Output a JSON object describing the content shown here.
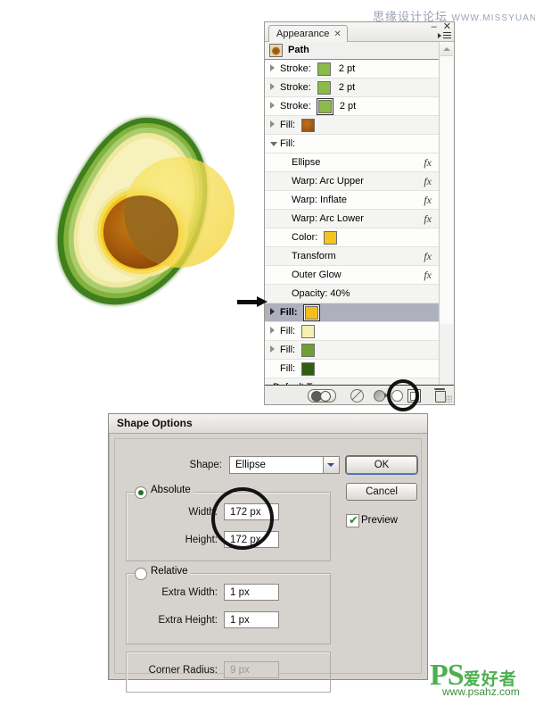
{
  "watermarks": {
    "top_cn": "思缘设计论坛",
    "top_url": "WWW.MISSYUAN.COM",
    "bottom_ps": "PS",
    "bottom_cn": "爱好者",
    "bottom_url": "www.psahz.com"
  },
  "artwork": {
    "name": "avocado-illustration",
    "colors": {
      "skin_dark": "#3f7a1e",
      "skin_mid": "#7fb03c",
      "skin_light": "#a8cc6a",
      "flesh_pale": "#f4f0a8",
      "flesh_rim": "#f7e36a",
      "ring_gold": "#f2c61e",
      "pit_dark": "#8a4a10",
      "pit_light": "#c1770f",
      "ellipse_yellow": "#f7d93a"
    }
  },
  "panel": {
    "tab_label": "Appearance",
    "tab_close": "✕",
    "window_minimize": "–",
    "window_close": "✕",
    "header_label": "Path",
    "menu_icon": "panel-menu-icon",
    "rows": [
      {
        "type": "stroke",
        "label": "Stroke:",
        "swatch": "#8cb94a",
        "value": "2 pt",
        "disclosure": "closed",
        "boxed": false,
        "fx": ""
      },
      {
        "type": "stroke",
        "label": "Stroke:",
        "swatch": "#8cb94a",
        "value": "2 pt",
        "disclosure": "closed",
        "boxed": false,
        "fx": ""
      },
      {
        "type": "stroke",
        "label": "Stroke:",
        "swatch": "#8cb94a",
        "value": "2 pt",
        "disclosure": "closed",
        "boxed": true,
        "fx": ""
      },
      {
        "type": "fill",
        "label": "Fill:",
        "swatch": "#a4540b",
        "value": "",
        "disclosure": "closed",
        "boxed": false,
        "fx": ""
      },
      {
        "type": "fill",
        "label": "Fill:",
        "swatch": "",
        "value": "",
        "disclosure": "open",
        "boxed": false,
        "fx": ""
      },
      {
        "type": "effect",
        "label": "Ellipse",
        "swatch": "",
        "value": "",
        "disclosure": "none",
        "boxed": false,
        "fx": "fx"
      },
      {
        "type": "effect",
        "label": "Warp: Arc Upper",
        "swatch": "",
        "value": "",
        "disclosure": "none",
        "boxed": false,
        "fx": "fx"
      },
      {
        "type": "effect",
        "label": "Warp: Inflate",
        "swatch": "",
        "value": "",
        "disclosure": "none",
        "boxed": false,
        "fx": "fx"
      },
      {
        "type": "effect",
        "label": "Warp: Arc Lower",
        "swatch": "",
        "value": "",
        "disclosure": "none",
        "boxed": false,
        "fx": "fx"
      },
      {
        "type": "color",
        "label": "Color:",
        "swatch": "#f2c61e",
        "value": "",
        "disclosure": "none",
        "boxed": false,
        "fx": ""
      },
      {
        "type": "effect",
        "label": "Transform",
        "swatch": "",
        "value": "",
        "disclosure": "none",
        "boxed": false,
        "fx": "fx"
      },
      {
        "type": "effect",
        "label": "Outer Glow",
        "swatch": "",
        "value": "",
        "disclosure": "none",
        "boxed": false,
        "fx": "fx"
      },
      {
        "type": "opacity",
        "label": "Opacity: 40%",
        "swatch": "",
        "value": "",
        "disclosure": "none",
        "boxed": false,
        "fx": ""
      },
      {
        "type": "fill",
        "label": "Fill:",
        "swatch": "#f2c01e",
        "value": "",
        "disclosure": "closed",
        "boxed": true,
        "fx": "",
        "selected": true
      },
      {
        "type": "fill",
        "label": "Fill:",
        "swatch": "#f7eeb4",
        "value": "",
        "disclosure": "closed",
        "boxed": false,
        "fx": ""
      },
      {
        "type": "fill",
        "label": "Fill:",
        "swatch": "#6f9e32",
        "value": "",
        "disclosure": "closed",
        "boxed": false,
        "fx": ""
      },
      {
        "type": "fill",
        "label": "Fill:",
        "swatch": "#2f5e14",
        "value": "",
        "disclosure": "none",
        "boxed": false,
        "fx": ""
      },
      {
        "type": "transparency",
        "label": "Default Transparency",
        "swatch": "",
        "value": "",
        "disclosure": "none",
        "boxed": false,
        "fx": ""
      }
    ],
    "footer": {
      "basic_appearance_toggle": "new-art-has-basic-appearance",
      "clear_appearance": "clear-appearance-icon",
      "reduce_to_basic": "reduce-to-basic-appearance-icon",
      "duplicate_item": "duplicate-selected-item-icon",
      "delete_item": "delete-selected-item-icon"
    }
  },
  "dialog": {
    "title": "Shape Options",
    "shape_label": "Shape:",
    "shape_value": "Ellipse",
    "shape_options": [
      "Ellipse"
    ],
    "absolute_label": "Absolute",
    "absolute_selected": true,
    "width_label": "Width:",
    "width_value": "172 px",
    "height_label": "Height:",
    "height_value": "172 px",
    "relative_label": "Relative",
    "relative_selected": false,
    "extra_width_label": "Extra Width:",
    "extra_width_value": "1 px",
    "extra_height_label": "Extra Height:",
    "extra_height_value": "1 px",
    "corner_radius_label": "Corner Radius:",
    "corner_radius_value": "9 px",
    "corner_radius_enabled": false,
    "ok_label": "OK",
    "cancel_label": "Cancel",
    "preview_label": "Preview",
    "preview_checked": true,
    "preview_tick": "✔"
  }
}
